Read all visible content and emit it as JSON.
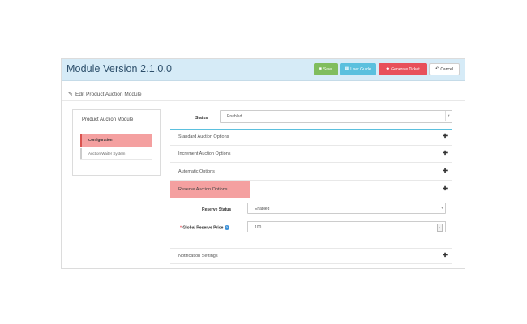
{
  "header": {
    "title": "Module Version 2.1.0.0",
    "buttons": {
      "save": "Save",
      "user_guide": "User Guide",
      "generate_ticket": "Generate Ticket",
      "cancel": "Cancel"
    }
  },
  "edit": {
    "label": "Edit Product Auction Module"
  },
  "sidebar": {
    "heading": "Product Auction Module",
    "items": [
      {
        "label": "Configuration",
        "active": true
      },
      {
        "label": "Auction Waiter System",
        "active": false
      }
    ]
  },
  "status": {
    "label": "Status",
    "value": "Enabled"
  },
  "sections": [
    {
      "label": "Standard Auction Options"
    },
    {
      "label": "Increment Auction Options"
    },
    {
      "label": "Automatic Options"
    },
    {
      "label": "Reserve Auction Options",
      "highlighted": true
    },
    {
      "label": "Notification Settings"
    }
  ],
  "reserve": {
    "status_label": "Reserve Status",
    "status_value": "Enabled",
    "price_label": "Global Reserve Price",
    "required_mark": "*",
    "help_icon": "question-circle-icon",
    "price_value": "100"
  },
  "colors": {
    "header_bg": "#d6ebf7",
    "save": "#80bd5e",
    "user_guide": "#5bc0de",
    "generate_ticket": "#e8505b",
    "highlight": "#f4a0a0"
  }
}
